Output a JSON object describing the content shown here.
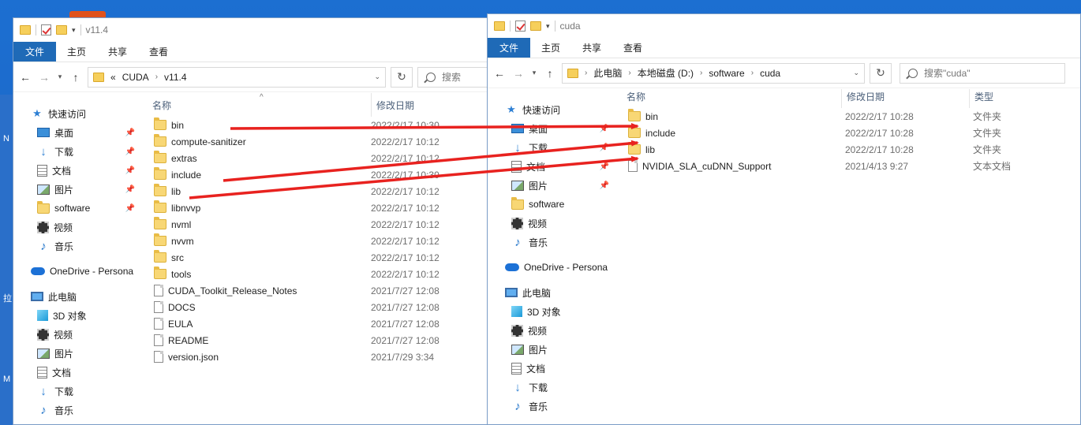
{
  "left_window": {
    "title": "v11.4",
    "ribbon": [
      "文件",
      "主页",
      "共享",
      "查看"
    ],
    "breadcrumb": [
      "«",
      "CUDA",
      "v11.4"
    ],
    "search_placeholder": "搜索",
    "nav_quick_access": "快速访问",
    "nav_items": [
      {
        "icon": "desktop-icon",
        "label": "桌面",
        "pinned": true
      },
      {
        "icon": "download-icon",
        "label": "下载",
        "pinned": true
      },
      {
        "icon": "document-icon",
        "label": "文档",
        "pinned": true
      },
      {
        "icon": "picture-icon",
        "label": "图片",
        "pinned": true
      },
      {
        "icon": "folder-icon",
        "label": "software",
        "pinned": true
      },
      {
        "icon": "video-icon",
        "label": "视频",
        "pinned": false
      },
      {
        "icon": "music-icon",
        "label": "音乐",
        "pinned": false
      }
    ],
    "nav_onedrive": "OneDrive - Persona",
    "nav_this_pc": "此电脑",
    "nav_pc_items": [
      {
        "icon": "3d-objects-icon",
        "label": "3D 对象"
      },
      {
        "icon": "video-icon",
        "label": "视频"
      },
      {
        "icon": "picture-icon",
        "label": "图片"
      },
      {
        "icon": "document-icon",
        "label": "文档"
      },
      {
        "icon": "download-icon",
        "label": "下载"
      },
      {
        "icon": "music-icon",
        "label": "音乐"
      }
    ],
    "columns": {
      "name": "名称",
      "date": "修改日期"
    },
    "files": [
      {
        "name": "bin",
        "date": "2022/2/17 10:30",
        "kind": "folder"
      },
      {
        "name": "compute-sanitizer",
        "date": "2022/2/17 10:12",
        "kind": "folder"
      },
      {
        "name": "extras",
        "date": "2022/2/17 10:12",
        "kind": "folder"
      },
      {
        "name": "include",
        "date": "2022/2/17 10:30",
        "kind": "folder"
      },
      {
        "name": "lib",
        "date": "2022/2/17 10:12",
        "kind": "folder"
      },
      {
        "name": "libnvvp",
        "date": "2022/2/17 10:12",
        "kind": "folder"
      },
      {
        "name": "nvml",
        "date": "2022/2/17 10:12",
        "kind": "folder"
      },
      {
        "name": "nvvm",
        "date": "2022/2/17 10:12",
        "kind": "folder"
      },
      {
        "name": "src",
        "date": "2022/2/17 10:12",
        "kind": "folder"
      },
      {
        "name": "tools",
        "date": "2022/2/17 10:12",
        "kind": "folder"
      },
      {
        "name": "CUDA_Toolkit_Release_Notes",
        "date": "2021/7/27 12:08",
        "kind": "file"
      },
      {
        "name": "DOCS",
        "date": "2021/7/27 12:08",
        "kind": "file"
      },
      {
        "name": "EULA",
        "date": "2021/7/27 12:08",
        "kind": "file"
      },
      {
        "name": "README",
        "date": "2021/7/27 12:08",
        "kind": "file"
      },
      {
        "name": "version.json",
        "date": "2021/7/29 3:34",
        "kind": "file"
      }
    ]
  },
  "right_window": {
    "title": "cuda",
    "ribbon": [
      "文件",
      "主页",
      "共享",
      "查看"
    ],
    "breadcrumb": [
      "此电脑",
      "本地磁盘 (D:)",
      "software",
      "cuda"
    ],
    "search_placeholder": "搜索\"cuda\"",
    "nav_quick_access": "快速访问",
    "nav_items": [
      {
        "icon": "desktop-icon",
        "label": "桌面",
        "pinned": true
      },
      {
        "icon": "download-icon",
        "label": "下载",
        "pinned": true
      },
      {
        "icon": "document-icon",
        "label": "文档",
        "pinned": true
      },
      {
        "icon": "picture-icon",
        "label": "图片",
        "pinned": true
      },
      {
        "icon": "folder-icon",
        "label": "software",
        "pinned": false
      },
      {
        "icon": "video-icon",
        "label": "视频",
        "pinned": false
      },
      {
        "icon": "music-icon",
        "label": "音乐",
        "pinned": false
      }
    ],
    "nav_onedrive": "OneDrive - Persona",
    "nav_this_pc": "此电脑",
    "nav_pc_items": [
      {
        "icon": "3d-objects-icon",
        "label": "3D 对象"
      },
      {
        "icon": "video-icon",
        "label": "视频"
      },
      {
        "icon": "picture-icon",
        "label": "图片"
      },
      {
        "icon": "document-icon",
        "label": "文档"
      },
      {
        "icon": "download-icon",
        "label": "下载"
      },
      {
        "icon": "music-icon",
        "label": "音乐"
      }
    ],
    "columns": {
      "name": "名称",
      "date": "修改日期",
      "type": "类型"
    },
    "files": [
      {
        "name": "bin",
        "date": "2022/2/17 10:28",
        "type": "文件夹",
        "kind": "folder"
      },
      {
        "name": "include",
        "date": "2022/2/17 10:28",
        "type": "文件夹",
        "kind": "folder"
      },
      {
        "name": "lib",
        "date": "2022/2/17 10:28",
        "type": "文件夹",
        "kind": "folder"
      },
      {
        "name": "NVIDIA_SLA_cuDNN_Support",
        "date": "2021/4/13 9:27",
        "type": "文本文档",
        "kind": "file"
      }
    ]
  },
  "colors": {
    "accent": "#1f6ab7",
    "arrow": "#e8221f",
    "desktop": "#1a64c7"
  }
}
